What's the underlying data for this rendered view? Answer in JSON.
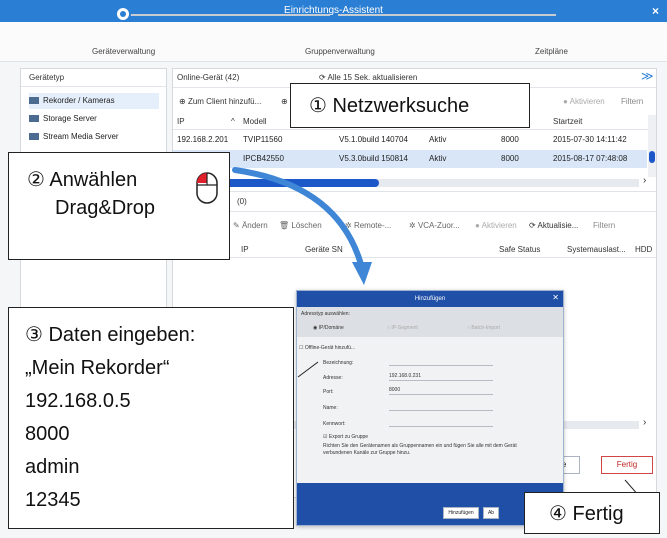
{
  "window": {
    "title": "Einrichtungs-Assistent",
    "close": "×"
  },
  "steps": [
    "Geräteverwaltung",
    "Gruppenverwaltung",
    "Zeitpläne"
  ],
  "left_panel": {
    "header": "Gerätetyp",
    "items": [
      "Rekorder / Kameras",
      "Storage Server",
      "Stream Media Server"
    ]
  },
  "online": {
    "title": "Online-Gerät (42)",
    "refresh": "Alle 15 Sek. aktualisieren",
    "add_client": "Zum Client hinzufü...",
    "activate": "Aktivieren",
    "filter": "Filtern",
    "columns": [
      "IP",
      "Modell",
      "Startzeit"
    ],
    "rows": [
      {
        "ip": "192.168.2.201",
        "model": "TVIP11560",
        "version": "V5.1.0build 140704",
        "status": "Aktiv",
        "port": "8000",
        "start": "2015-07-30 14:11:42"
      },
      {
        "ip": "",
        "model": "IPCB42550",
        "version": "V5.3.0build 150814",
        "status": "Aktiv",
        "port": "8000",
        "start": "2015-08-17 07:48:08"
      }
    ]
  },
  "managed": {
    "title": "(0)",
    "toolbar": [
      "Ändern",
      "Löschen",
      "Remote-...",
      "VCA-Zuor...",
      "Aktivieren",
      "Aktualisie...",
      "Filtern"
    ],
    "columns": [
      "IP",
      "Geräte SN",
      "Safe Status",
      "Systemauslast...",
      "HDD"
    ]
  },
  "dialog": {
    "title": "Hinzufügen",
    "address_type_label": "Adresstyp auswählen:",
    "address_types": [
      "IP/Domäne",
      "IP-Segment",
      "Batch-Import"
    ],
    "offline_label": "Offline-Gerät hinzufü...",
    "fields": [
      {
        "label": "Bezeichnung:",
        "value": ""
      },
      {
        "label": "Adresse:",
        "value": "192.168.0.231"
      },
      {
        "label": "Port:",
        "value": "8000"
      },
      {
        "label": "Name:",
        "value": ""
      },
      {
        "label": "Kennwort:",
        "value": ""
      }
    ],
    "export_label": "Export zu Gruppe",
    "hint": "Richten Sie den Gerätenamen als Gruppennamen ein und fügen Sie alle mit dem Gerät verbundenen Kanäle zur Gruppe hinzu.",
    "add_button": "Hinzufügen",
    "cancel_button": "Ab"
  },
  "back_button": "te",
  "finish_button": "Fertig",
  "callouts": {
    "c1": "① Netzwerksuche",
    "c2_line1": "② Anwählen",
    "c2_line2": "Drag&Drop",
    "c3": [
      "③ Daten eingeben:",
      "„Mein Rekorder“",
      "192.168.0.5",
      "8000",
      "admin",
      "12345"
    ],
    "c4": "④ Fertig"
  },
  "colors": {
    "titlebar": "#2a7fd4",
    "dialog_title": "#1f4fa7",
    "arrow": "#3f87d6",
    "finish_border": "#d04545"
  }
}
